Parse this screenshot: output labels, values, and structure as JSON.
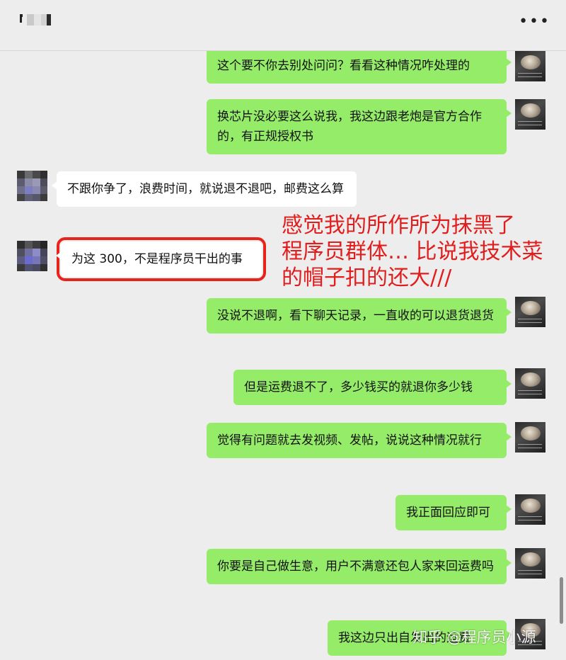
{
  "header": {
    "more_label": "•••"
  },
  "messages": [
    {
      "side": "me",
      "text": "这个要不你去别处问问？看看这种情况咋处理的"
    },
    {
      "side": "me",
      "text": "换芯片没必要这么说我，我这边跟老炮是官方合作的，有正规授权书"
    },
    {
      "side": "them",
      "text": "不跟你争了，浪费时间，就说退不退吧，邮费这么算"
    },
    {
      "side": "them",
      "text": "为这 300，不是程序员干出的事"
    },
    {
      "side": "me",
      "text": "没说不退啊，看下聊天记录，一直收的可以退货退货"
    },
    {
      "side": "me",
      "text": "但是运费退不了，多少钱买的就退你多少钱"
    },
    {
      "side": "me",
      "text": "觉得有问题就去发视频、发帖，说说这种情况就行"
    },
    {
      "side": "me",
      "text": "我正面回应即可"
    },
    {
      "side": "me",
      "text": "你要是自己做生意，用户不满意还包人家来回运费吗"
    },
    {
      "side": "me",
      "text": "我这边只出自发出的运费"
    }
  ],
  "annotation": {
    "line1": "感觉我的所作所为抹黑了",
    "line2": "程序员群体… 比说我技术菜",
    "line3": "的帽子扣的还大///"
  },
  "watermark": "知乎 @程序员小源",
  "colors": {
    "background": "#ededed",
    "my_bubble": "#95ec69",
    "their_bubble": "#ffffff",
    "highlight_border": "#e8231b",
    "annotation_text": "#e11d1d"
  }
}
